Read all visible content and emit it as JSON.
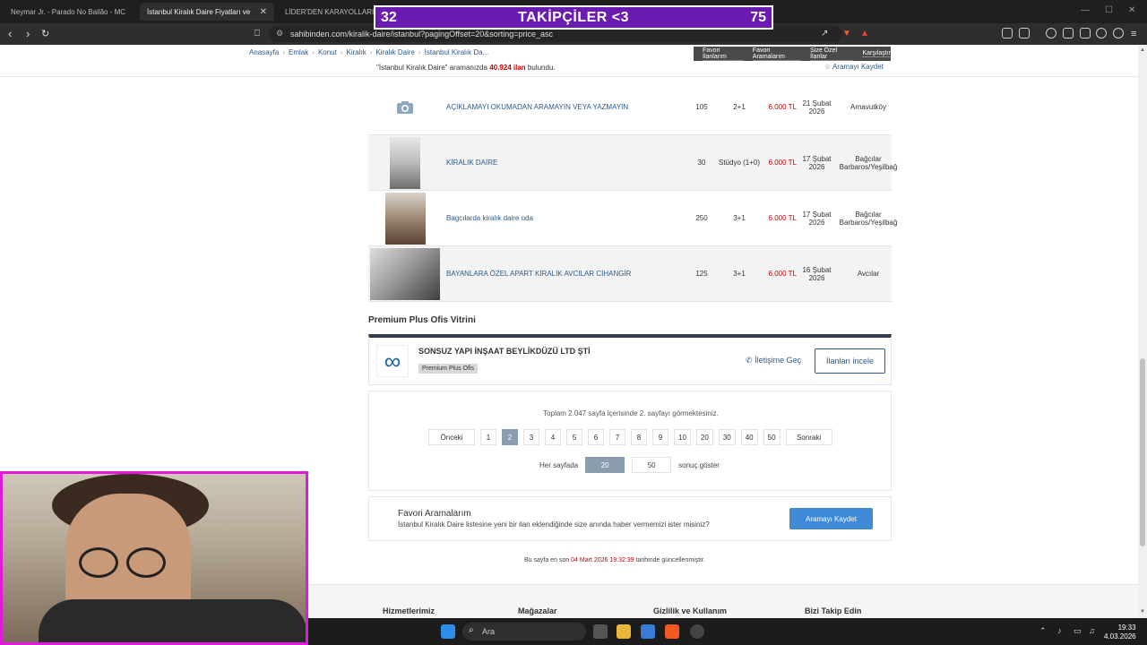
{
  "browser": {
    "tabs": [
      {
        "label": "Neymar Jr. - Parado No Bailão - MC",
        "color": "#e62117"
      },
      {
        "label": "İstanbul Kiralık Daire Fiyatları ve",
        "color": "#ffd400"
      },
      {
        "label": "LİDER'DEN KARAYOLLARI",
        "color": "#ffd400"
      }
    ],
    "url": "sahibinden.com/kiralik-daire/istanbul?pagingOffset=20&sorting=price_asc"
  },
  "overlay": {
    "left_num": "32",
    "label": "TAKİPÇİLER <3",
    "right_num": "75"
  },
  "header": {
    "breadcrumbs": [
      "Anasayfa",
      "Emlak",
      "Konut",
      "Kiralık",
      "Kiralık Daire",
      "İstanbul Kiralık Da..."
    ],
    "top_links": [
      "Favori İlanlarım",
      "Favori Aramalarım",
      "Size Özel İlanlar",
      "Karşılaştır"
    ],
    "found_prefix": "\"İstanbul Kiralık Daire\" aramanızda",
    "found_count": "40.924 ilan",
    "found_suffix": "bulundu.",
    "save_search": "Aramayı Kaydet"
  },
  "listings": [
    {
      "title": "AÇIKLAMAYI OKUMADAN ARAMAYIN VEYA YAZMAYIN",
      "m2": "105",
      "rooms": "2+1",
      "price": "6.000 TL",
      "date": "21 Şubat 2026",
      "location": "Arnavutköy",
      "has_photo": false
    },
    {
      "title": "KİRALIK DAİRE",
      "m2": "30",
      "rooms": "Stüdyo (1+0)",
      "price": "6.000 TL",
      "date": "17 Şubat 2026",
      "location": "Bağcılar Barbaros/Yeşilbağ",
      "has_photo": true
    },
    {
      "title": "Bagcılarda kiralık daire oda",
      "m2": "250",
      "rooms": "3+1",
      "price": "6.000 TL",
      "date": "17 Şubat 2026",
      "location": "Bağcılar Barbaros/Yeşilbağ",
      "has_photo": true
    },
    {
      "title": "BAYANLARA ÖZEL APART KİRALİK AVCILAR CİHANGİR",
      "m2": "125",
      "rooms": "3+1",
      "price": "6.000 TL",
      "date": "16 Şubat 2026",
      "location": "Avcılar",
      "has_photo": true
    }
  ],
  "premium": {
    "section_title": "Premium Plus Ofis Vitrini",
    "company": "SONSUZ YAPI İNŞAAT BEYLİKDÜZÜ LTD ŞTİ",
    "badge": "Premium Plus Ofis",
    "contact": "İletişime Geç",
    "listings_button": "İlanları incele"
  },
  "pager": {
    "info": "Toplam 2.047 sayfa içerisinde 2. sayfayı görmektesiniz.",
    "prev": "Önceki",
    "next": "Sonraki",
    "pages": [
      "1",
      "2",
      "3",
      "4",
      "5",
      "6",
      "7",
      "8",
      "9",
      "10",
      "20",
      "30",
      "40",
      "50"
    ],
    "current": "2",
    "per_page_label": "Her sayfada",
    "per_page_options": [
      "20",
      "50"
    ],
    "per_page_suffix": "sonuç göster"
  },
  "favorites": {
    "title": "Favori Aramalarım",
    "desc": "İstanbul Kiralık Daire listesine yeni bir ilan eklendiğinde size anında haber vermemizi ister misiniz?",
    "button": "Aramayı Kaydet"
  },
  "updated": {
    "prefix": "Bu sayfa en son",
    "date": "04 Mart 2026 19:32:39",
    "suffix": "tarihinde güncellenmiştir."
  },
  "footer": {
    "headings": [
      "Hizmetlerimiz",
      "Mağazalar",
      "Gizlilik ve Kullanım",
      "Bizi Takip Edin"
    ]
  },
  "taskbar": {
    "search_placeholder": "Ara",
    "time": "19:33",
    "date": "4.03.2026"
  },
  "colors": {
    "price": "#c80000",
    "link": "#2e5a8a",
    "overlay": "#6a1bb0",
    "webcam_border": "#e01ad8",
    "primary_button": "#3f8ad6"
  }
}
